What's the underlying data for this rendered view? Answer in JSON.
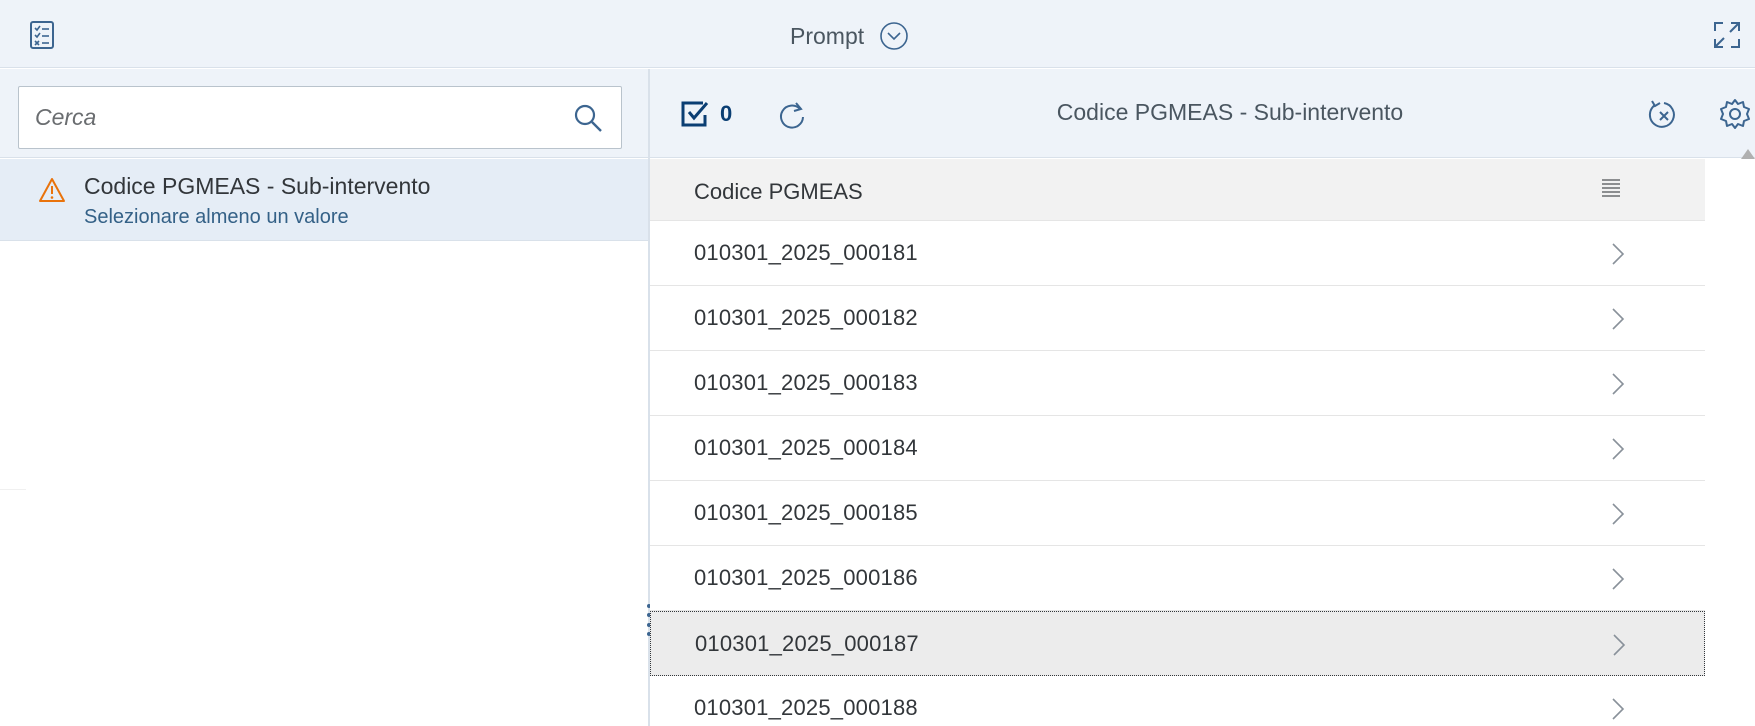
{
  "header": {
    "title": "Prompt"
  },
  "left": {
    "search": {
      "placeholder": "Cerca",
      "value": ""
    },
    "prompt_item": {
      "name": "Codice PGMEAS - Sub-intervento",
      "hint": "Selezionare almeno un valore"
    }
  },
  "right": {
    "toolbar": {
      "selected_count": "0",
      "title": "Codice PGMEAS - Sub-intervento"
    },
    "list": {
      "header": "Codice PGMEAS",
      "rows": [
        "010301_2025_000181",
        "010301_2025_000182",
        "010301_2025_000183",
        "010301_2025_000184",
        "010301_2025_000185",
        "010301_2025_000186",
        "010301_2025_000187",
        "010301_2025_000188"
      ],
      "selected_row": "010301_2025_000187"
    }
  },
  "colors": {
    "accent": "#0a6ed1",
    "warning": "#e9730c",
    "header_bg": "#eef3f9",
    "selected_item_bg": "#e5edf6"
  },
  "icons": {
    "top_left": "checklist-icon",
    "title_dropdown": "chevron-down-circle-icon",
    "top_right": "expand-icon",
    "search": "search-icon",
    "warning": "warning-icon",
    "select_all": "checkbox-checked-icon",
    "refresh": "refresh-icon",
    "clear": "clear-selection-icon",
    "settings": "gear-icon",
    "column_menu": "list-menu-icon",
    "row_nav": "chevron-right-icon"
  }
}
